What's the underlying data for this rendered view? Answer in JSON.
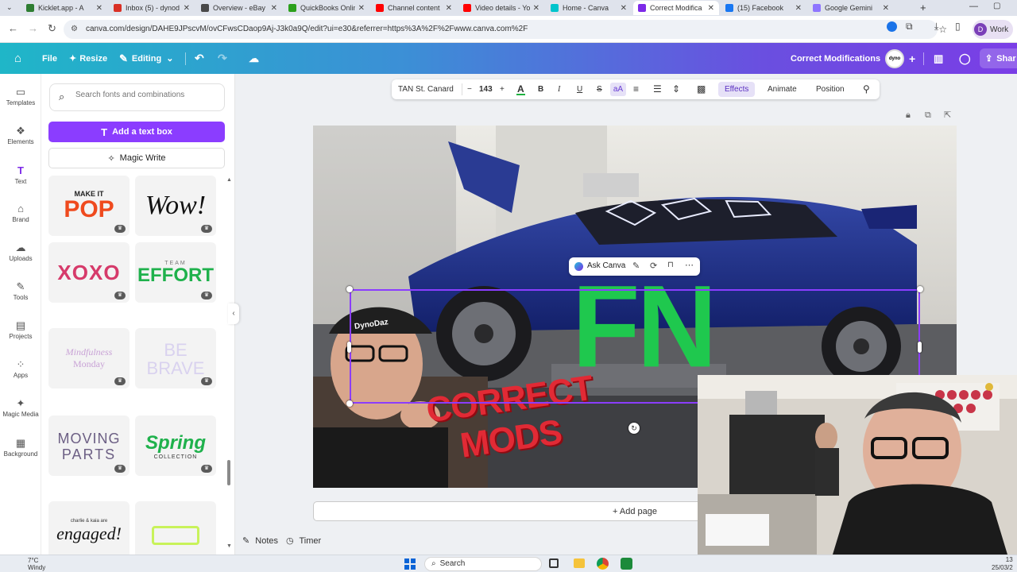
{
  "browser": {
    "tabs": [
      {
        "title": "Kicklet.app - A",
        "color": "#2e7d32"
      },
      {
        "title": "Inbox (5) - dynod",
        "color": "#d93025"
      },
      {
        "title": "Overview - eBay S",
        "color": "#4a4a4a"
      },
      {
        "title": "QuickBooks Onlin",
        "color": "#2ca01c"
      },
      {
        "title": "Channel content",
        "color": "#ff0000"
      },
      {
        "title": "Video details - Yo",
        "color": "#ff0000"
      },
      {
        "title": "Home - Canva",
        "color": "#00c4cc"
      },
      {
        "title": "Correct Modifica",
        "color": "#7d2ae8"
      },
      {
        "title": "(15) Facebook",
        "color": "#1877f2"
      },
      {
        "title": "Google Gemini",
        "color": "#8e75ff"
      }
    ],
    "url": "canva.com/design/DAHE9JPscvM/ovCFwsCDaop9Aj-J3k0a9Q/edit?ui=e30&referrer=https%3A%2F%2Fwww.canva.com%2F",
    "profile_label": "Work",
    "profile_initial": "D"
  },
  "canva_header": {
    "file": "File",
    "resize": "Resize",
    "editing": "Editing",
    "title": "Correct Modifications",
    "share": "Shar"
  },
  "rail": [
    {
      "label": "Templates",
      "icon": "templates-icon",
      "glyph": "▭"
    },
    {
      "label": "Elements",
      "icon": "elements-icon",
      "glyph": "❖"
    },
    {
      "label": "Text",
      "icon": "text-icon",
      "glyph": "T"
    },
    {
      "label": "Brand",
      "icon": "brand-icon",
      "glyph": "⌂"
    },
    {
      "label": "Uploads",
      "icon": "uploads-icon",
      "glyph": "☁"
    },
    {
      "label": "Tools",
      "icon": "tools-icon",
      "glyph": "✎"
    },
    {
      "label": "Projects",
      "icon": "projects-icon",
      "glyph": "▤"
    },
    {
      "label": "Apps",
      "icon": "apps-icon",
      "glyph": "⁘"
    },
    {
      "label": "Magic Media",
      "icon": "magic-media-icon",
      "glyph": "✦"
    },
    {
      "label": "Background",
      "icon": "background-icon",
      "glyph": "▦"
    }
  ],
  "panel": {
    "search_placeholder": "Search fonts and combinations",
    "add_text_box": "Add a text box",
    "magic_write": "Magic Write",
    "cards": [
      {
        "line1": "MAKE IT",
        "line2": "POP"
      },
      {
        "line1": "Wow!",
        "line2": ""
      },
      {
        "line1": "XOXO",
        "line2": ""
      },
      {
        "line1": "TEAM",
        "line2": "EFFORT"
      },
      {
        "line1": "Mindfulness",
        "line2": "Monday"
      },
      {
        "line1": "BE",
        "line2": "BRAVE"
      },
      {
        "line1": "MOVING",
        "line2": "PARTS"
      },
      {
        "line1": "Spring",
        "line2": "COLLECTION"
      },
      {
        "line1": "charlie & kaia are",
        "line2": "engaged!"
      },
      {
        "line1": "",
        "line2": ""
      }
    ]
  },
  "format_bar": {
    "font": "TAN St. Canard",
    "size": "143",
    "effects": "Effects",
    "animate": "Animate",
    "position": "Position"
  },
  "design": {
    "ask_canva": "Ask Canva",
    "big_text": "FN",
    "overlay_text_1": "CORRECT",
    "overlay_text_2": "MODS",
    "cap_text": "DynoDaz"
  },
  "footer": {
    "add_page": "+ Add page",
    "notes": "Notes",
    "timer": "Timer"
  },
  "taskbar": {
    "weather_temp": "7°C",
    "weather_desc": "Windy",
    "search": "Search",
    "time": "13",
    "date": "25/03/2"
  }
}
